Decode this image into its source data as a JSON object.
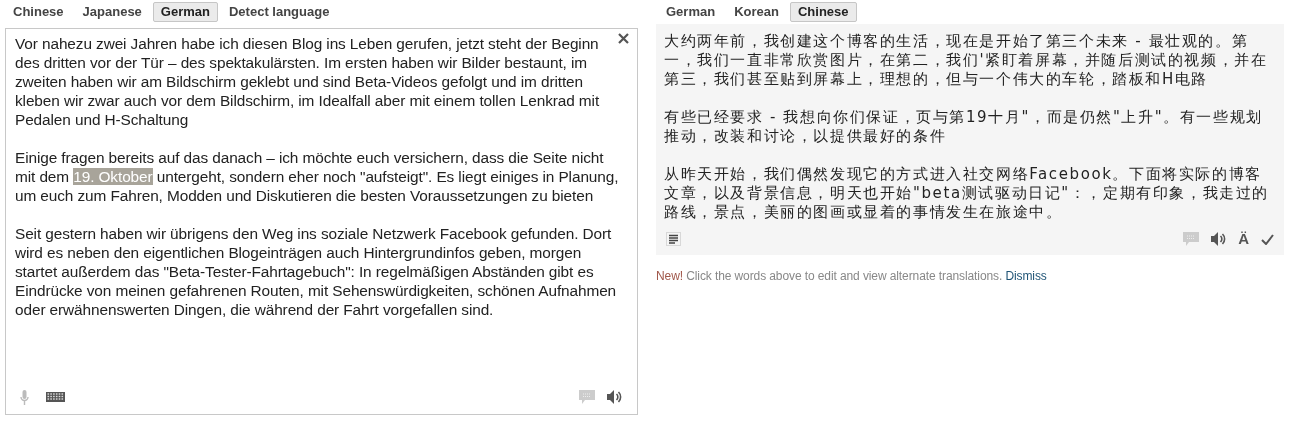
{
  "source": {
    "tabs": [
      {
        "label": "Chinese",
        "selected": false
      },
      {
        "label": "Japanese",
        "selected": false
      },
      {
        "label": "German",
        "selected": true
      },
      {
        "label": "Detect language",
        "selected": false
      }
    ],
    "paragraphs": [
      [
        {
          "text": "Vor nahezu zwei Jahren habe ich diesen Blog ins Leben gerufen, jetzt steht der Beginn des dritten vor der Tür – des spektakulärsten. Im ersten haben wir Bilder bestaunt, im zweiten haben wir am Bildschirm geklebt und sind Beta-Videos gefolgt und im dritten kleben wir zwar auch vor dem Bildschirm, im Idealfall aber mit einem tollen Lenkrad mit Pedalen und H-Schaltung",
          "highlighted": false
        }
      ],
      [
        {
          "text": "Einige fragen bereits auf das danach – ich möchte euch versichern, dass die Seite nicht mit dem ",
          "highlighted": false
        },
        {
          "text": "19. Oktober",
          "highlighted": true
        },
        {
          "text": " untergeht, sondern eher noch \"aufsteigt\". Es liegt einiges in Planung, um euch zum Fahren, Modden und Diskutieren die besten Voraussetzungen zu bieten",
          "highlighted": false
        }
      ],
      [
        {
          "text": "Seit gestern haben wir übrigens den Weg ins soziale Netzwerk Facebook gefunden. Dort wird es neben den eigentlichen Blogeinträgen auch Hintergrundinfos geben, morgen startet außerdem das \"Beta-Tester-Fahrtagebuch\": In regelmäßigen Abständen gibt es Eindrücke von meinen gefahrenen Routen, mit Sehenswürdigkeiten, schönen Aufnahmen oder erwähnenswerten Dingen, die während der Fahrt vorgefallen sind.",
          "highlighted": false
        }
      ]
    ]
  },
  "target": {
    "tabs": [
      {
        "label": "German",
        "selected": false
      },
      {
        "label": "Korean",
        "selected": false
      },
      {
        "label": "Chinese",
        "selected": true
      }
    ],
    "paragraphs": [
      "大约两年前，我创建这个博客的生活，现在是开始了第三个未来 - 最壮观的。第一，我们一直非常欣赏图片，在第二，我们'紧盯着屏幕，并随后测试的视频，并在第三，我们甚至贴到屏幕上，理想的，但与一个伟大的车轮，踏板和H电路",
      "有些已经要求 - 我想向你们保证，页与第19十月\"，而是仍然\"上升\"。有一些规划推动，改装和讨论，以提供最好的条件",
      "从昨天开始，我们偶然发现它的方式进入社交网络Facebook。下面将实际的博客文章，以及背景信息，明天也开始\"beta测试驱动日记\"：，定期有印象，我走过的路线，景点，美丽的图画或显着的事情发生在旅途中。"
    ],
    "romanize_label": "Ä"
  },
  "notice": {
    "badge": "New!",
    "message": "Click the words above to edit and view alternate translations.",
    "dismiss": "Dismiss"
  }
}
